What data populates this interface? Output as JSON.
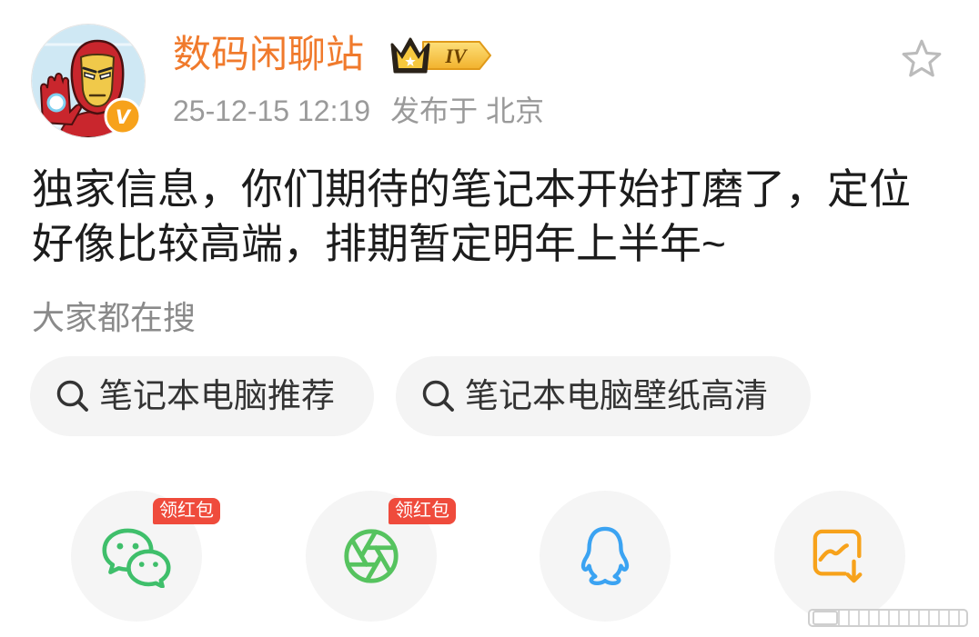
{
  "colors": {
    "accent": "#f07a2c",
    "text": "#1c1c1c",
    "muted": "#9a9a9a",
    "chip_bg": "#f4f4f4",
    "circle_bg": "#f5f5f5",
    "badge_red": "#ef4b3c",
    "verified": "#f7a21b",
    "wechat": "#3fbf6b",
    "moments": "#56c35f",
    "qq": "#3ba3f2",
    "save": "#f7a21b"
  },
  "post": {
    "author": {
      "name": "数码闲聊站",
      "avatar_icon": "iron-man-avatar",
      "verified_badge": {
        "icon": "verified-v-badge-icon",
        "letter": "V"
      },
      "level_badge": {
        "icon": "crown-icon",
        "label": "IV"
      }
    },
    "meta": {
      "timestamp": "25-12-15 12:19",
      "location": "发布于 北京"
    },
    "favorite_icon": "star-icon",
    "text": "独家信息，你们期待的笔记本开始打磨了，定位好像比较高端，排期暂定明年上半年~"
  },
  "trending": {
    "title": "大家都在搜",
    "items": [
      {
        "icon": "search-icon",
        "label": "笔记本电脑推荐"
      },
      {
        "icon": "search-icon",
        "label": "笔记本电脑壁纸高清"
      }
    ]
  },
  "share": {
    "items": [
      {
        "icon": "wechat-icon",
        "badge": "领红包"
      },
      {
        "icon": "moments-icon",
        "badge": "领红包"
      },
      {
        "icon": "qq-icon"
      },
      {
        "icon": "save-image-icon"
      }
    ]
  }
}
